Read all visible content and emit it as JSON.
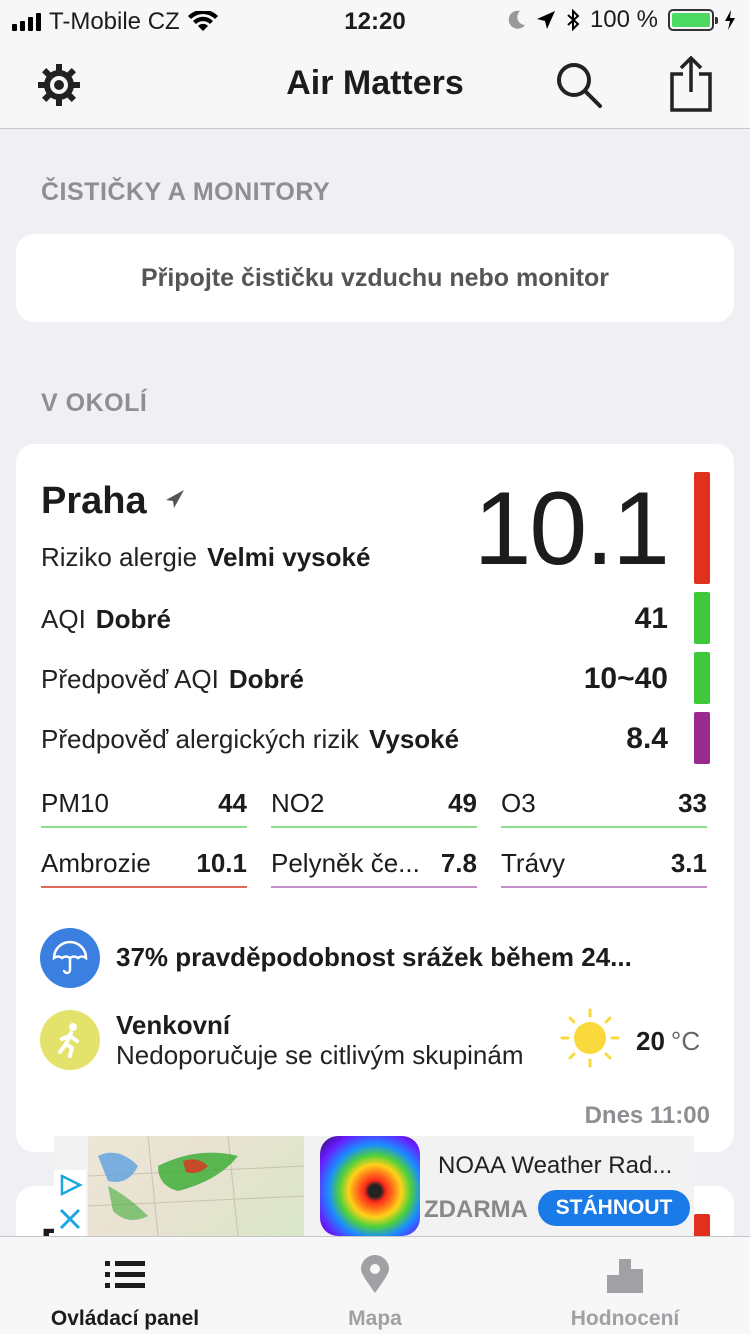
{
  "status_bar": {
    "carrier": "T-Mobile CZ",
    "time": "12:20",
    "battery": "100 %",
    "battery_level": 1.0
  },
  "navbar": {
    "title": "Air Matters",
    "icons": [
      "gear-icon",
      "search-icon",
      "share-icon"
    ]
  },
  "sections": {
    "devices_header": "ČISTIČKY A MONITORY",
    "connect_text": "Připojte čističku vzduchu nebo monitor",
    "nearby_header": "V OKOLÍ"
  },
  "location": {
    "city": "Praha",
    "main_value": "10.1",
    "allergy_label": "Riziko alergie",
    "allergy_level": "Velmi vysoké",
    "aqi_label": "AQI",
    "aqi_level": "Dobré",
    "aqi_value": "41",
    "forecast_aqi_label": "Předpověď AQI",
    "forecast_aqi_level": "Dobré",
    "forecast_aqi_value": "10~40",
    "forecast_allergy_label": "Předpověď alergických rizik",
    "forecast_allergy_level": "Vysoké",
    "forecast_allergy_value": "8.4",
    "colors": {
      "main": "#e0301e",
      "aqi": "#3fc93a",
      "forecast_aqi": "#3fc93a",
      "forecast_allergy": "#9a2a90"
    },
    "metrics": [
      {
        "name": "PM10",
        "value": "44",
        "color": "#8fdc8a"
      },
      {
        "name": "NO2",
        "value": "49",
        "color": "#8fdc8a"
      },
      {
        "name": "O3",
        "value": "33",
        "color": "#8fdc8a"
      },
      {
        "name": "Ambrozie",
        "value": "10.1",
        "color": "#e06a5a"
      },
      {
        "name": "Pelyněk če...",
        "value": "7.8",
        "color": "#c58ec8"
      },
      {
        "name": "Trávy",
        "value": "3.1",
        "color": "#c58ec8"
      }
    ],
    "rain_text": "37% pravděpodobnost srážek během 24...",
    "outdoor_title": "Venkovní",
    "outdoor_sub": "Nedoporučuje se citlivým skupinám",
    "temperature": "20",
    "temperature_unit": "°C",
    "updated": "Dnes 11:00"
  },
  "ad": {
    "title": "NOAA Weather Rad...",
    "price": "ZDARMA",
    "button": "STÁHNOUT"
  },
  "tabs": [
    {
      "label": "Ovládací panel",
      "icon": "list-icon",
      "active": true
    },
    {
      "label": "Mapa",
      "icon": "map-pin-icon",
      "active": false
    },
    {
      "label": "Hodnocení",
      "icon": "ranking-icon",
      "active": false
    }
  ]
}
